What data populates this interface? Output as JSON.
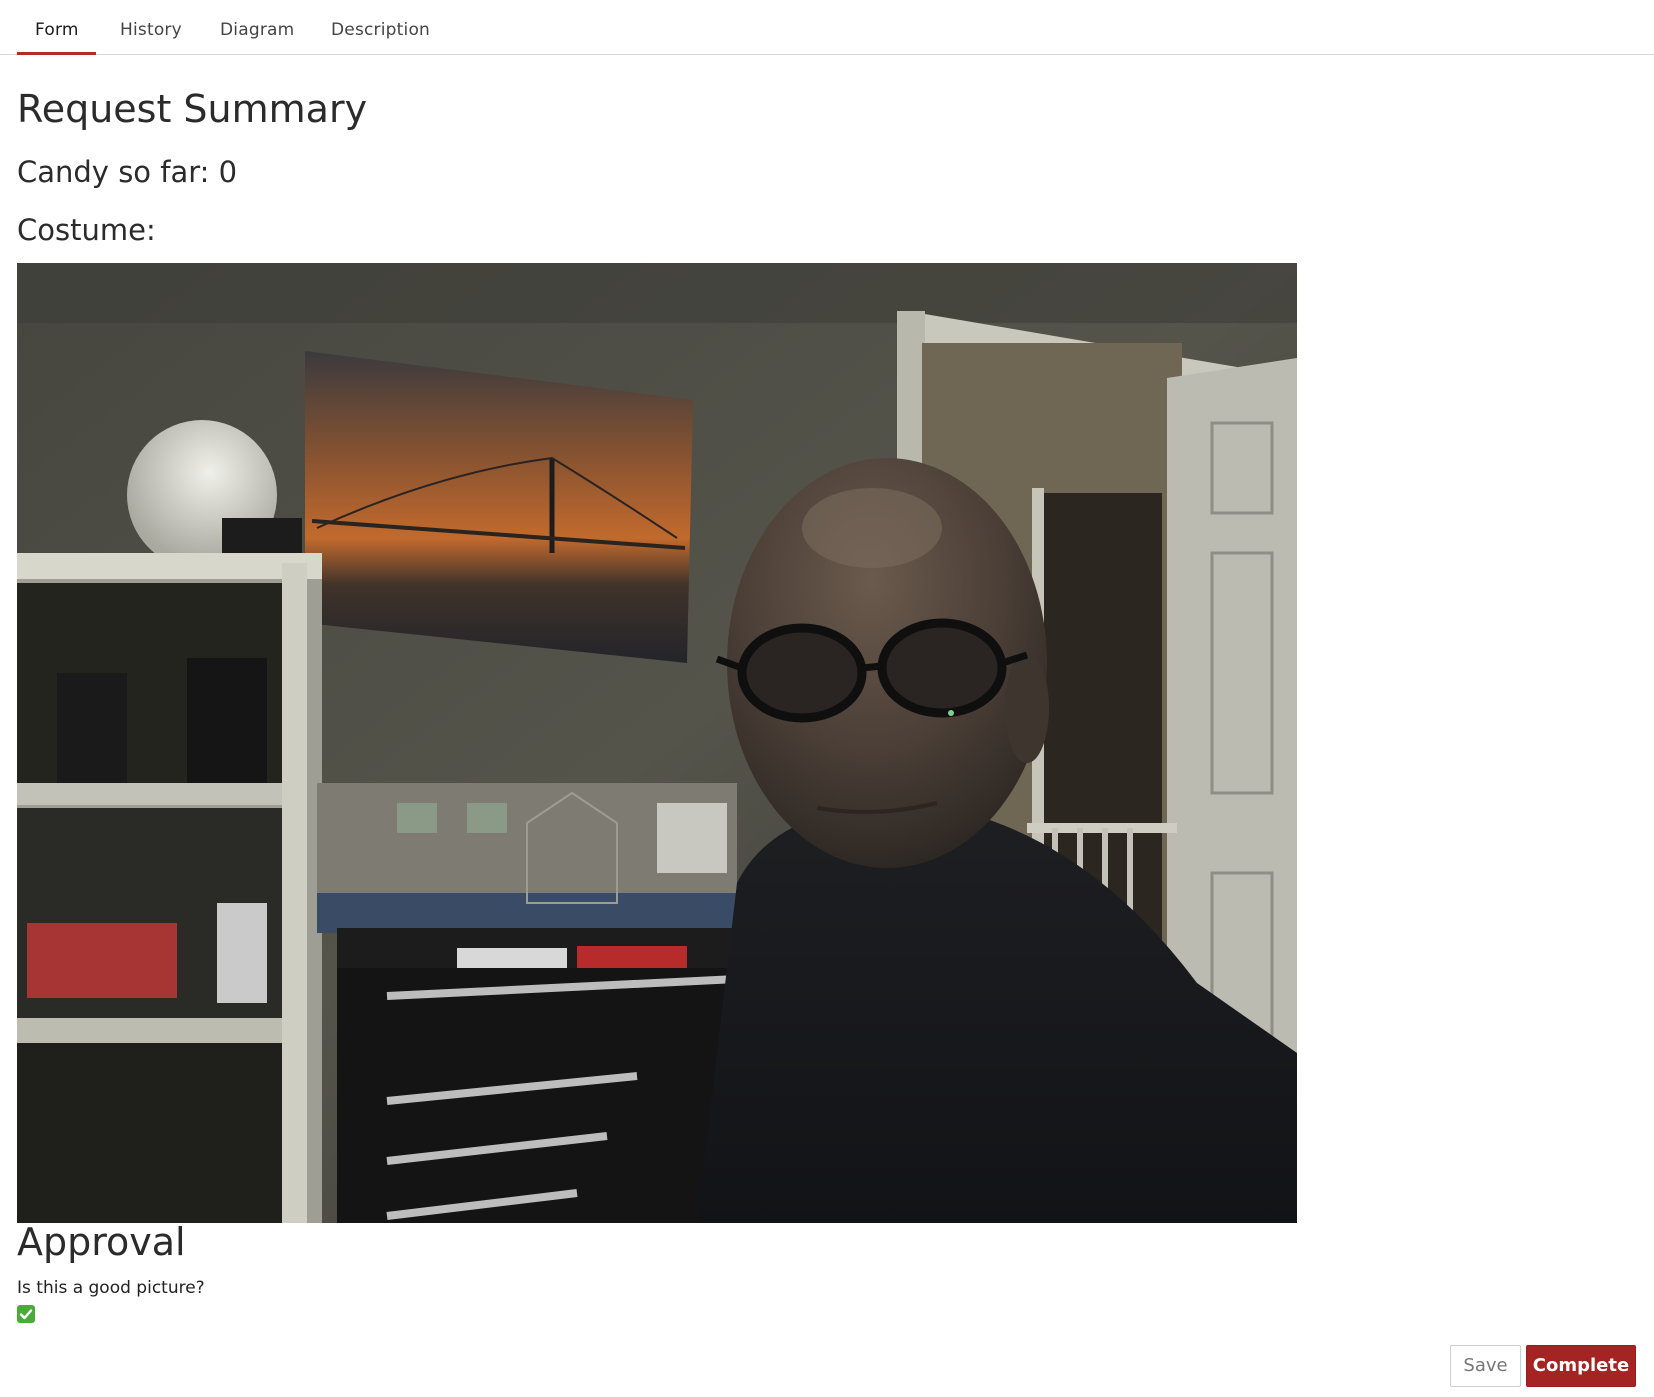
{
  "tabs": [
    {
      "label": "Form",
      "active": true
    },
    {
      "label": "History",
      "active": false
    },
    {
      "label": "Diagram",
      "active": false
    },
    {
      "label": "Description",
      "active": false
    }
  ],
  "summary": {
    "title": "Request Summary",
    "candy_line": "Candy so far: 0",
    "costume_label": "Costume:"
  },
  "approval": {
    "title": "Approval",
    "question": "Is this a good picture?",
    "checked": true
  },
  "actions": {
    "save_label": "Save",
    "complete_label": "Complete"
  },
  "colors": {
    "accent": "#a42323",
    "check": "#4caa3c"
  }
}
